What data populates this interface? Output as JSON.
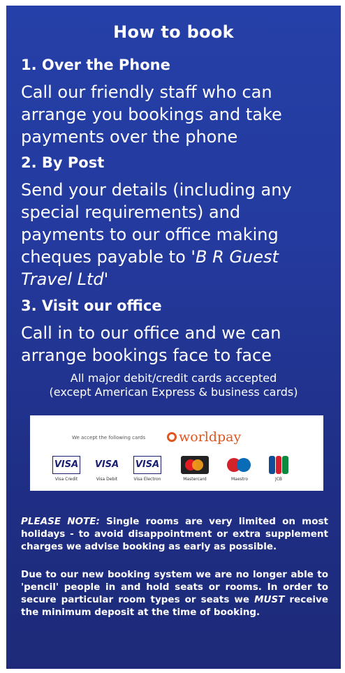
{
  "title": "How to book",
  "phone": {
    "heading": "1. Over the Phone",
    "text": "Call our friendly staff who can arrange you bookings and take payments over the phone"
  },
  "post": {
    "heading": "2. By Post",
    "text": "Send your details (including any special requirements) and payments to our office making cheques payable to ",
    "payee": "'B R Guest Travel Ltd'"
  },
  "office": {
    "heading": "3. Visit our office",
    "text": "Call in to our office and we can arrange bookings face to face"
  },
  "cards": {
    "line1": "All major debit/credit cards accepted",
    "line2": "(except American Express & business cards)",
    "accept_text": "We accept the following cards",
    "worldpay": "worldpay",
    "visa_label": "VISA",
    "captions": [
      "Visa Credit",
      "Visa Debit",
      "Visa Electron",
      "Mastercard",
      "Maestro",
      "JCB"
    ],
    "colors": {
      "visa": "#1a1f71",
      "mastercard_red": "#e21b23",
      "mastercard_orange": "#f8a01b",
      "maestro_blue": "#0a6bb7",
      "worldpay": "#e0561e"
    }
  },
  "notes": {
    "note1_label": "PLEASE NOTE:",
    "note1_text": " Single rooms are very limited on most holidays - to avoid disappointment or extra supplement charges we advise booking as early as possible.",
    "note2_text_a": "Due to our new booking system we are no longer able to 'pencil' people in and hold seats or rooms. In order to secure particular room types or seats we ",
    "note2_must": "MUST",
    "note2_text_b": " receive the minimum deposit at the time of booking."
  },
  "colors": {
    "panel_top": "#2540a8",
    "panel_bottom": "#1e2a79"
  }
}
